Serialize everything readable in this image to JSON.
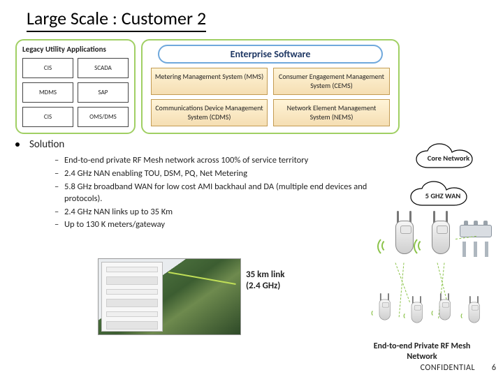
{
  "title": "Large Scale : Customer 2",
  "legacy": {
    "header": "Legacy Utility Applications",
    "rows": [
      [
        "CIS",
        "SCADA"
      ],
      [
        "MDMS",
        "SAP"
      ],
      [
        "CIS",
        "OMS/DMS"
      ]
    ]
  },
  "enterprise": {
    "header": "Enterprise Software",
    "cells": [
      [
        "Metering Management System (MMS)",
        "Consumer Engagement Management System (CEMS)"
      ],
      [
        "Communications Device Management System (CDMS)",
        "Network Element Management System (NEMS)"
      ]
    ]
  },
  "solution": {
    "header": "Solution",
    "items": [
      "End-to-end private RF Mesh network across 100% of service territory",
      "2.4 GHz NAN enabling  TOU, DSM, PQ, Net Metering",
      "5.8 GHz broadband WAN for low cost AMI backhaul and DA (multiple end devices and protocols).",
      "2.4 GHz NAN links up to 35 Km",
      "Up to 130 K meters/gateway"
    ]
  },
  "clouds": {
    "core": "Core Network",
    "wan": "5 GHZ WAN"
  },
  "map": {
    "callout_line1": "35 km link",
    "callout_line2": "(2.4 GHz)"
  },
  "footer": {
    "mesh_label": "End-to-end Private RF Mesh Network",
    "confidential": "CONFIDENTIAL",
    "page": "6"
  }
}
